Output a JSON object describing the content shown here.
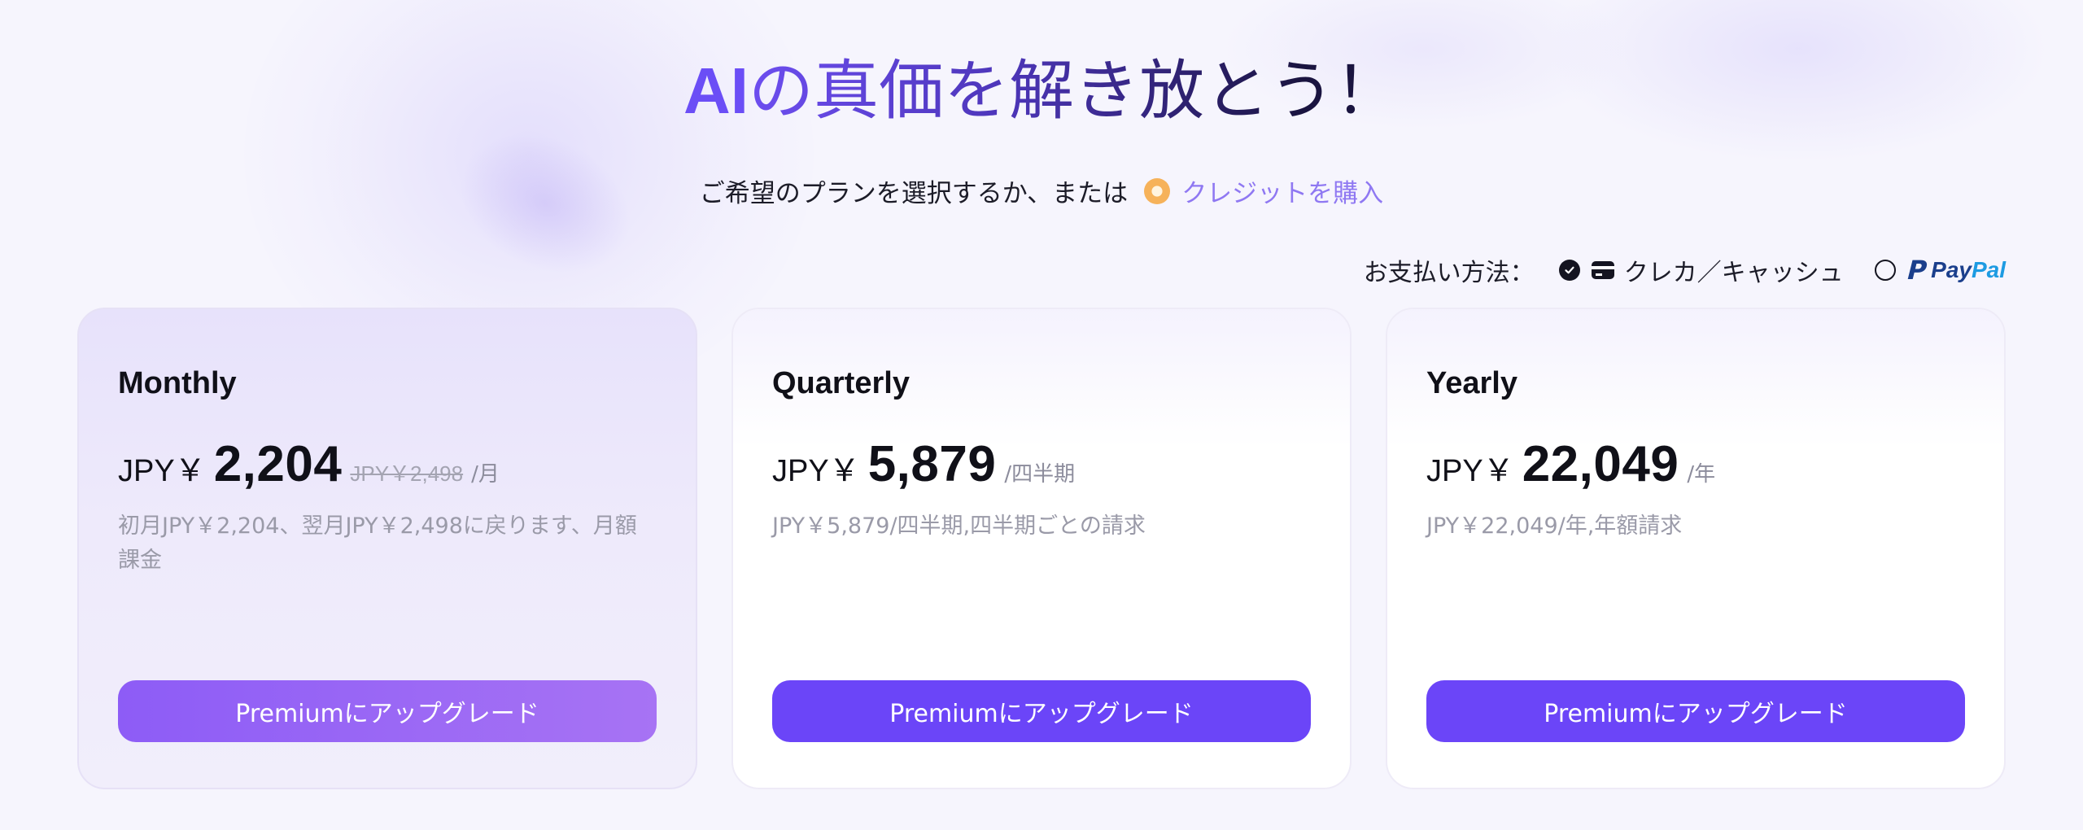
{
  "header": {
    "title_ai": "AI",
    "title_rest": "の真価を解き放とう！",
    "subtitle": "ご希望のプランを選択するか、または",
    "credit_link": "クレジットを購入"
  },
  "payment": {
    "label": "お支払い方法：",
    "options": [
      {
        "label": "クレカ／キャッシュ",
        "selected": true,
        "icon": "credit-card-icon"
      },
      {
        "label_a": "Pay",
        "label_b": "Pal",
        "selected": false,
        "icon": "paypal-icon"
      }
    ]
  },
  "plans": [
    {
      "name": "Monthly",
      "currency": "JPY￥",
      "price": "2,204",
      "old_price": "JPY￥2,498",
      "period": "/月",
      "description": "初月JPY￥2,204、翌月JPY￥2,498に戻ります、月額課金",
      "button": "Premiumにアップグレード",
      "highlighted": true
    },
    {
      "name": "Quarterly",
      "currency": "JPY￥",
      "price": "5,879",
      "period": "/四半期",
      "description": "JPY￥5,879/四半期,四半期ごとの請求",
      "button": "Premiumにアップグレード",
      "highlighted": false
    },
    {
      "name": "Yearly",
      "currency": "JPY￥",
      "price": "22,049",
      "period": "/年",
      "description": "JPY￥22,049/年,年額請求",
      "button": "Premiumにアップグレード",
      "highlighted": false
    }
  ],
  "colors": {
    "accent": "#6b45f8",
    "accent_gradient_start": "#8d5cf6",
    "accent_gradient_end": "#a773f4",
    "credit_link": "#8f78f2",
    "coin": "#f6b25a",
    "paypal_dark": "#1b3f8c",
    "paypal_light": "#1d9be2"
  }
}
